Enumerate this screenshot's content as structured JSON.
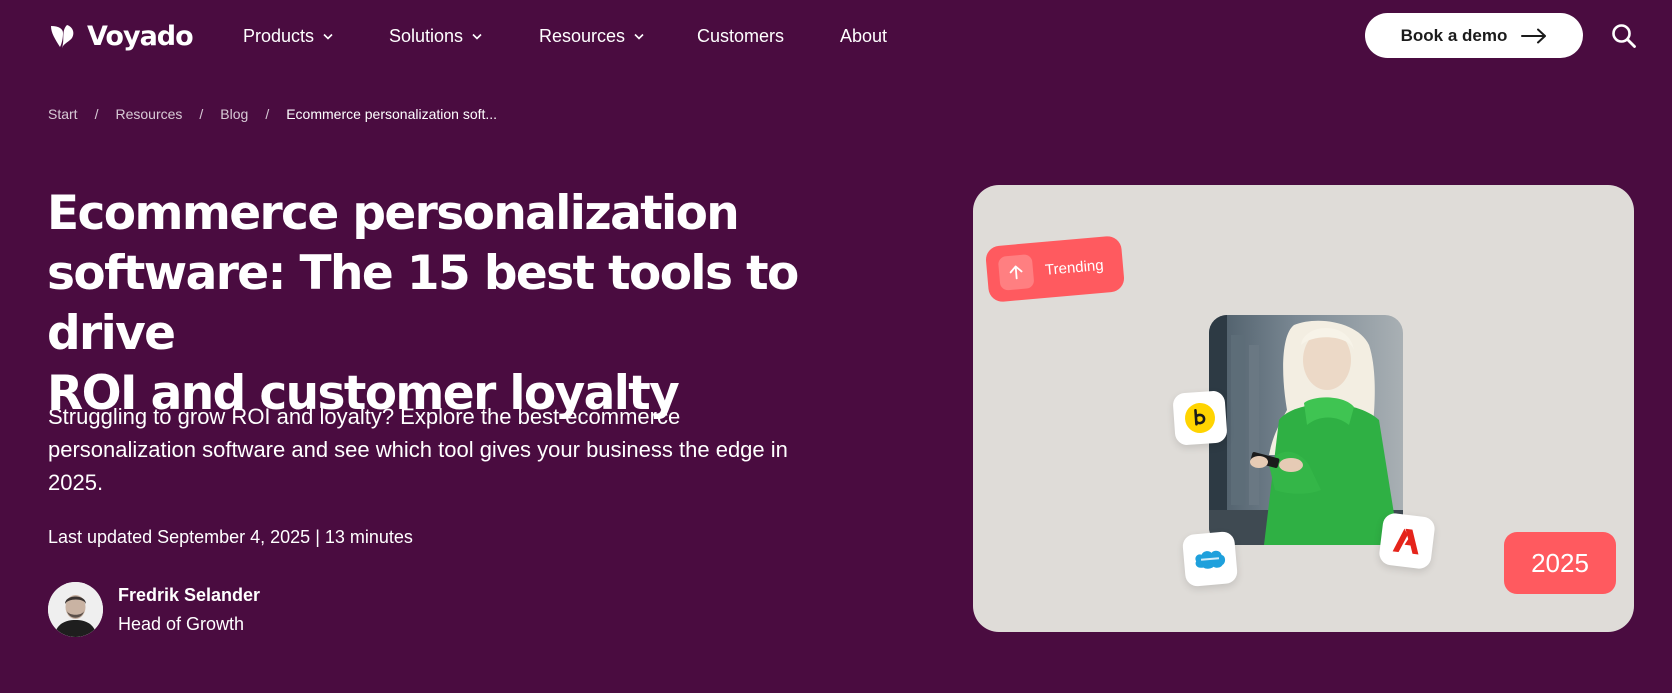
{
  "header": {
    "logo_text": "Voyado",
    "nav": [
      {
        "label": "Products",
        "has_dropdown": true
      },
      {
        "label": "Solutions",
        "has_dropdown": true
      },
      {
        "label": "Resources",
        "has_dropdown": true
      },
      {
        "label": "Customers",
        "has_dropdown": false
      },
      {
        "label": "About",
        "has_dropdown": false
      }
    ],
    "cta_label": "Book a demo",
    "search_icon": "search-icon"
  },
  "breadcrumb": [
    "Start",
    "Resources",
    "Blog",
    "Ecommerce personalization soft..."
  ],
  "hero": {
    "title_lines": [
      "Ecommerce personalization",
      "software: The 15 best tools to drive",
      "ROI and customer loyalty"
    ],
    "subtitle_lines": [
      "Struggling to grow ROI and loyalty? Explore the best ecommerce",
      "personalization software and see which tool gives your business the edge in",
      "2025."
    ],
    "meta": "Last updated September 4, 2025 | 13 minutes",
    "author": {
      "name": "Fredrik Selander",
      "role": "Head of Growth"
    }
  },
  "card": {
    "trending_label": "Trending",
    "year_label": "2025",
    "badges": [
      "bloomreach-logo",
      "salesforce-logo",
      "adobe-logo"
    ]
  },
  "colors": {
    "background": "#4a0c40",
    "card_background": "#dfdcd8",
    "accent": "#ff5a5f",
    "cta_background": "#ffffff"
  }
}
